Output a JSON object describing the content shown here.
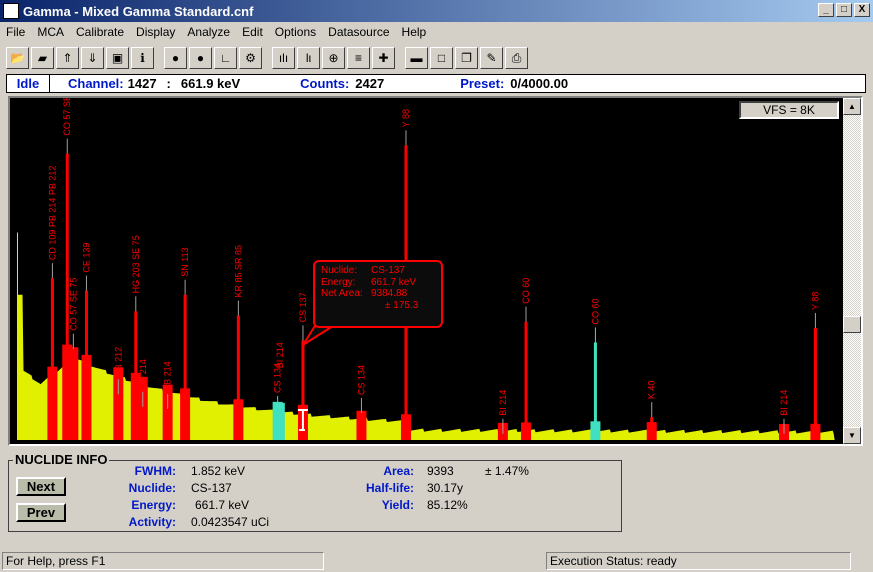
{
  "window": {
    "title": "Gamma - Mixed Gamma Standard.cnf",
    "controls": [
      "_",
      "□",
      "X"
    ]
  },
  "menu": [
    "File",
    "MCA",
    "Calibrate",
    "Display",
    "Analyze",
    "Edit",
    "Options",
    "Datasource",
    "Help"
  ],
  "toolbar": [
    "open-icon",
    "open-folder-icon",
    "upload-icon",
    "download-icon",
    "save-icon",
    "info-icon",
    "start-icon",
    "stop-icon",
    "clear-icon",
    "settings-icon",
    "linear-scale-icon",
    "log-scale-icon",
    "zoom-icon",
    "overlay-icon",
    "plus-icon",
    "minus-icon",
    "maximize-icon",
    "restore-icon",
    "tool-icon",
    "print-icon"
  ],
  "status": {
    "state": "Idle",
    "channel_label": "Channel:",
    "channel": "1427",
    "sep": ":",
    "energy": "661.9 keV",
    "counts_label": "Counts:",
    "counts": "2427",
    "preset_label": "Preset:",
    "preset": "0/4000.00"
  },
  "vfs": "VFS = 8K",
  "colors": {
    "background": "#000000",
    "continuum": "#e0f000",
    "roi": "#ff0000",
    "unidentified": "#40e0c0"
  },
  "chart_data": {
    "type": "bar",
    "vfs_counts": 8192,
    "x_unit": "keV",
    "cursor_energy": 661.9,
    "peaks": [
      {
        "energy": 88,
        "label": "CD 109  PB 214  PB 212",
        "counts": 3900,
        "color": "red"
      },
      {
        "energy": 122,
        "label": "CO 57  SE 75",
        "counts": 6900,
        "color": "red"
      },
      {
        "energy": 136,
        "label": "CO 57  SE 75",
        "counts": 2200,
        "color": "red"
      },
      {
        "energy": 166,
        "label": "CE 139",
        "counts": 3600,
        "color": "red"
      },
      {
        "energy": 239,
        "label": "PB 212",
        "counts": 1100,
        "color": "red"
      },
      {
        "energy": 279,
        "label": "HG 203  SE 75",
        "counts": 3100,
        "color": "red"
      },
      {
        "energy": 295,
        "label": "PB 214",
        "counts": 800,
        "color": "red"
      },
      {
        "energy": 352,
        "label": "PB 214",
        "counts": 750,
        "color": "red"
      },
      {
        "energy": 392,
        "label": "SN 113",
        "counts": 3500,
        "color": "red"
      },
      {
        "energy": 514,
        "label": "KR 85  SR 85",
        "counts": 3000,
        "color": "red"
      },
      {
        "energy": 604,
        "label": "CS 134",
        "counts": 700,
        "color": "cyan"
      },
      {
        "energy": 609,
        "label": "BI 214",
        "counts": 0,
        "color": "cyan"
      },
      {
        "energy": 662,
        "label": "CS 137",
        "counts": 2400,
        "color": "red"
      },
      {
        "energy": 796,
        "label": "CS 134",
        "counts": 650,
        "color": "red"
      },
      {
        "energy": 898,
        "label": "Y 88",
        "counts": 7100,
        "color": "red"
      },
      {
        "energy": 1120,
        "label": "BI 214",
        "counts": 150,
        "color": "red"
      },
      {
        "energy": 1173,
        "label": "CO 60",
        "counts": 2850,
        "color": "red"
      },
      {
        "energy": 1332,
        "label": "CO 60",
        "counts": 2350,
        "color": "cyan"
      },
      {
        "energy": 1461,
        "label": "K 40",
        "counts": 550,
        "color": "red"
      },
      {
        "energy": 1764,
        "label": "BI 214",
        "counts": 150,
        "color": "red"
      },
      {
        "energy": 1836,
        "label": "Y 88",
        "counts": 2700,
        "color": "red"
      }
    ]
  },
  "callout": {
    "nuclide_label": "Nuclide:",
    "nuclide": "CS-137",
    "energy_label": "Energy:",
    "energy": "661.7 keV",
    "area_label": "Net Area:",
    "area": "9384.88",
    "uncertainty": "± 175.3"
  },
  "nuclide_info": {
    "title": "NUCLIDE INFO",
    "next": "Next",
    "prev": "Prev",
    "fwhm_label": "FWHM:",
    "fwhm": "1.852 keV",
    "nuclide_label": "Nuclide:",
    "nuclide": "CS-137",
    "energy_label": "Energy:",
    "energy": "661.7 keV",
    "activity_label": "Activity:",
    "activity": "0.0423547 uCi",
    "area_label": "Area:",
    "area": "9393",
    "area_unc": "± 1.47%",
    "halflife_label": "Half-life:",
    "halflife": "30.17y",
    "yield_label": "Yield:",
    "yield": "85.12%"
  },
  "statusbar": {
    "help": "For Help, press F1",
    "exec": "Execution Status: ready"
  }
}
